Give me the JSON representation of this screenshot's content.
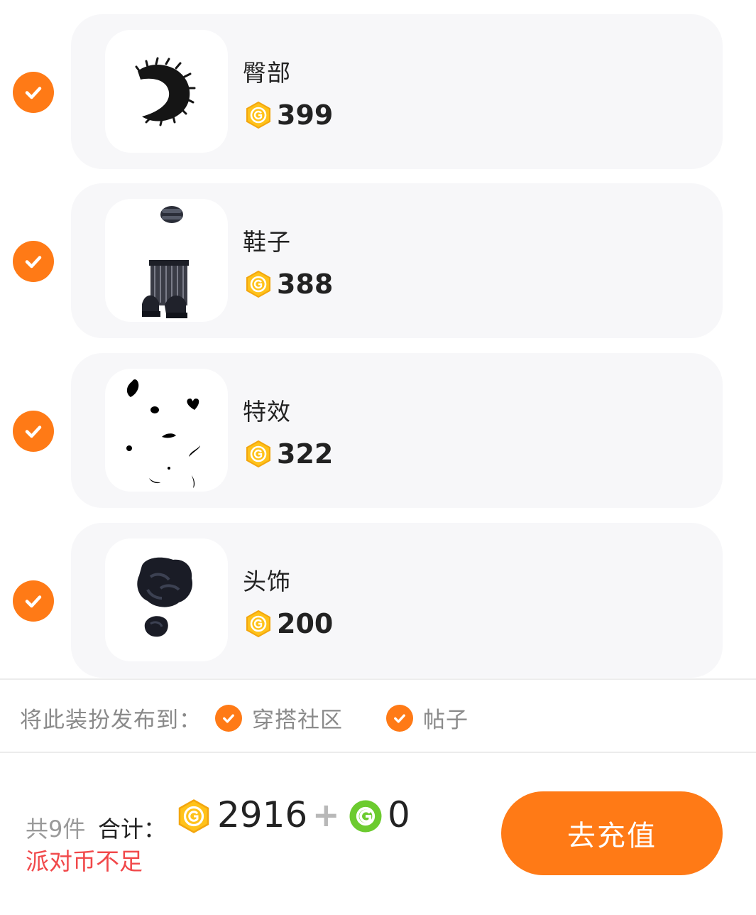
{
  "items": [
    {
      "name": "臀部",
      "price": "399",
      "checked": true,
      "thumb": "tail"
    },
    {
      "name": "鞋子",
      "price": "388",
      "checked": true,
      "thumb": "shoes"
    },
    {
      "name": "特效",
      "price": "322",
      "checked": true,
      "thumb": "petals"
    },
    {
      "name": "头饰",
      "price": "200",
      "checked": true,
      "thumb": "headpiece"
    }
  ],
  "publish": {
    "label": "将此装扮发布到：",
    "options": [
      {
        "label": "穿搭社区",
        "checked": true
      },
      {
        "label": "帖子",
        "checked": true
      }
    ]
  },
  "footer": {
    "count": "共9件",
    "total_label": "合计：",
    "party_coins": "2916",
    "plus": "+",
    "green_coins": "0",
    "warning": "派对币不足",
    "recharge_label": "去充值"
  },
  "colors": {
    "accent": "#ff7a16",
    "card_bg": "#f7f7f9",
    "warning": "#f1484a",
    "gold_coin": "#ffc21a",
    "green_coin": "#6ccb2f"
  }
}
